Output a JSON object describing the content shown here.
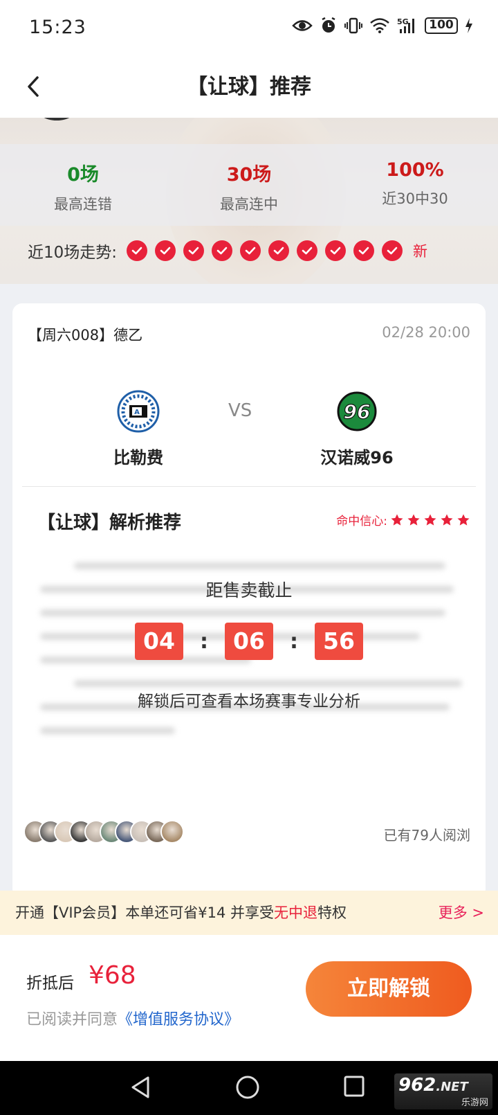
{
  "status_bar": {
    "time": "15:23",
    "battery": "100",
    "network": "5G",
    "icons": [
      "eye-icon",
      "alarm-icon",
      "vibrate-icon",
      "wifi-icon",
      "signal-icon",
      "battery-icon",
      "charging-icon"
    ]
  },
  "nav": {
    "title": "【让球】推荐",
    "back_icon": "chevron-left-icon"
  },
  "stats": [
    {
      "value": "0场",
      "label": "最高连错",
      "color": "#1a8a2a"
    },
    {
      "value": "30场",
      "label": "最高连中",
      "color": "#cc1a1a"
    },
    {
      "value": "100%",
      "label": "近30中30",
      "color": "#cc1a1a"
    }
  ],
  "trend": {
    "label": "近10场走势:",
    "results": [
      "hit",
      "hit",
      "hit",
      "hit",
      "hit",
      "hit",
      "hit",
      "hit",
      "hit",
      "hit"
    ],
    "new_label": "新"
  },
  "match": {
    "header": "【周六008】德乙",
    "datetime": "02/28 20:00",
    "home_team": "比勒费",
    "away_team": "汉诺威96",
    "vs": "VS",
    "away_logo_text": "96"
  },
  "analysis": {
    "title": "【让球】解析推荐",
    "confidence_label": "命中信心:",
    "confidence_stars": 5
  },
  "countdown": {
    "title": "距售卖截止",
    "hours": "04",
    "minutes": "06",
    "seconds": "56",
    "separator": ":",
    "hint": "解锁后可查看本场赛事专业分析"
  },
  "readers": {
    "count_text": "已有79人阅浏",
    "avatar_count": 10
  },
  "vip": {
    "text_pre": "开通【VIP会员】本单还可省¥14 并享受",
    "text_red": "无中退",
    "text_post": "特权",
    "more": "更多 >"
  },
  "purchase": {
    "price_label": "折抵后",
    "price": "¥68",
    "agree_text": "已阅读并同意",
    "agree_link": "《增值服务协议》",
    "button": "立即解锁"
  },
  "watermark": {
    "brand": "962",
    "suffix": ".NET",
    "sub": "乐游网"
  },
  "colors": {
    "accent_red": "#e8213a",
    "button_orange": "#ef5b1f",
    "countdown_red": "#ef4b3f",
    "vip_bg": "#fdf3dc"
  }
}
